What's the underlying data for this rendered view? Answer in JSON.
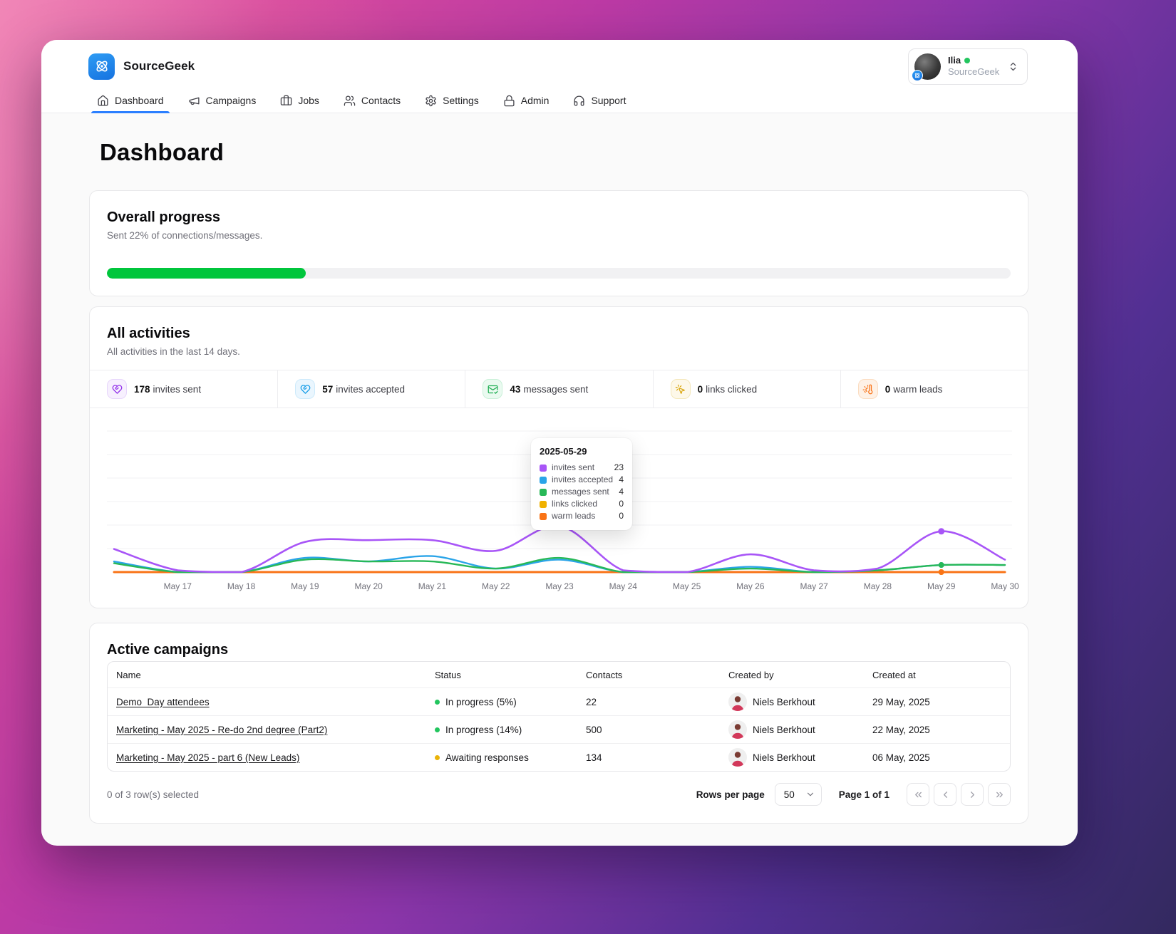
{
  "brand": {
    "name": "SourceGeek"
  },
  "nav": {
    "items": [
      {
        "label": "Dashboard",
        "active": true
      },
      {
        "label": "Campaigns",
        "active": false
      },
      {
        "label": "Jobs",
        "active": false
      },
      {
        "label": "Contacts",
        "active": false
      },
      {
        "label": "Settings",
        "active": false
      },
      {
        "label": "Admin",
        "active": false
      },
      {
        "label": "Support",
        "active": false
      }
    ]
  },
  "user": {
    "name": "Ilia",
    "org": "SourceGeek",
    "online_color": "#22c55e"
  },
  "page": {
    "title": "Dashboard"
  },
  "overall": {
    "title": "Overall progress",
    "subtitle": "Sent 22% of connections/messages.",
    "percent": 22,
    "bar_color": "#00c63c"
  },
  "activities": {
    "title": "All activities",
    "subtitle": "All activities in the last 14 days.",
    "stats": [
      {
        "value": "178",
        "label": "invites sent",
        "color": "#9333ea"
      },
      {
        "value": "57",
        "label": "invites accepted",
        "color": "#199ee8"
      },
      {
        "value": "43",
        "label": "messages sent",
        "color": "#1fae53"
      },
      {
        "value": "0",
        "label": "links clicked",
        "color": "#d9a409"
      },
      {
        "value": "0",
        "label": "warm leads",
        "color": "#f97316"
      }
    ]
  },
  "chart_data": {
    "type": "line",
    "x_labels": [
      "",
      "May 17",
      "May 18",
      "May 19",
      "May 20",
      "May 21",
      "May 22",
      "May 23",
      "May 24",
      "May 25",
      "May 26",
      "May 27",
      "May 28",
      "May 29",
      "May 30"
    ],
    "series": [
      {
        "name": "invites sent",
        "color": "#a855f7",
        "values": [
          13,
          1,
          0,
          17,
          18,
          18,
          12,
          26,
          1,
          0,
          10,
          1,
          2,
          23,
          7
        ]
      },
      {
        "name": "invites accepted",
        "color": "#2aa4e8",
        "values": [
          6,
          0,
          0,
          8,
          6,
          9,
          2,
          7,
          0,
          0,
          3,
          0,
          1,
          4,
          4
        ]
      },
      {
        "name": "messages sent",
        "color": "#27b857",
        "values": [
          5,
          0,
          0,
          7,
          6,
          6,
          2,
          8,
          0,
          0,
          2,
          0,
          1,
          4,
          4
        ]
      },
      {
        "name": "links clicked",
        "color": "#f0b100",
        "values": [
          0,
          0,
          0,
          0,
          0,
          0,
          0,
          0,
          0,
          0,
          0,
          0,
          0,
          0,
          0
        ]
      },
      {
        "name": "warm leads",
        "color": "#f97316",
        "values": [
          0,
          0,
          0,
          0,
          0,
          0,
          0,
          0,
          0,
          0,
          0,
          0,
          0,
          0,
          0
        ]
      }
    ],
    "ylim": [
      0,
      90
    ],
    "grid": true,
    "highlight_index": 13,
    "tooltip": {
      "title": "2025-05-29",
      "rows": [
        {
          "label": "invites sent",
          "value": "23",
          "color": "#a855f7"
        },
        {
          "label": "invites accepted",
          "value": "4",
          "color": "#2aa4e8"
        },
        {
          "label": "messages sent",
          "value": "4",
          "color": "#27b857"
        },
        {
          "label": "links clicked",
          "value": "0",
          "color": "#f0b100"
        },
        {
          "label": "warm leads",
          "value": "0",
          "color": "#f97316"
        }
      ]
    }
  },
  "campaigns": {
    "title": "Active campaigns",
    "columns": [
      "Name",
      "Status",
      "Contacts",
      "Created by",
      "Created at"
    ],
    "rows": [
      {
        "name": "Demo_Day attendees",
        "status": "In progress (5%)",
        "status_color": "#22c55e",
        "contacts": "22",
        "created_by": "Niels Berkhout",
        "created_at": "29 May, 2025"
      },
      {
        "name": "Marketing - May 2025 - Re-do 2nd degree (Part2)",
        "status": "In progress (14%)",
        "status_color": "#22c55e",
        "contacts": "500",
        "created_by": "Niels Berkhout",
        "created_at": "22 May, 2025"
      },
      {
        "name": "Marketing - May 2025 - part 6 (New Leads)",
        "status": "Awaiting responses",
        "status_color": "#eab308",
        "contacts": "134",
        "created_by": "Niels Berkhout",
        "created_at": "06 May, 2025"
      }
    ],
    "footer": {
      "selected": "0 of 3 row(s) selected",
      "rows_per_page_label": "Rows per page",
      "rows_per_page_value": "50",
      "page": "Page 1 of 1"
    }
  }
}
